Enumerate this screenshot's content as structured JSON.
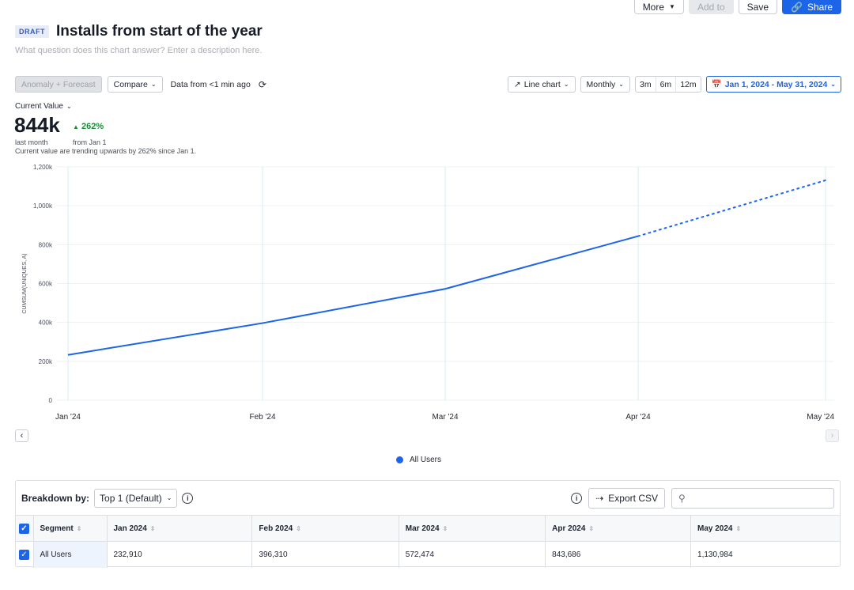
{
  "topbar": {
    "more": "More",
    "add_to": "Add to",
    "save": "Save",
    "share": "Share"
  },
  "header": {
    "badge": "DRAFT",
    "title": "Installs from start of the year",
    "description": "What question does this chart answer? Enter a description here."
  },
  "toolbar": {
    "anomaly": "Anomaly + Forecast",
    "compare": "Compare",
    "data_status": "Data from <1 min ago",
    "chart_type": "Line chart",
    "interval": "Monthly",
    "ranges": [
      "3m",
      "6m",
      "12m"
    ],
    "date_range": "Jan 1, 2024 - May 31, 2024"
  },
  "summary": {
    "label": "Current Value",
    "value": "844k",
    "delta": "262%",
    "value_caption": "last month",
    "delta_caption": "from Jan 1",
    "trend_text": "Current value are trending upwards by 262% since Jan 1."
  },
  "chart_data": {
    "type": "line",
    "ylabel": "CUMSUM(UNIQUES, A)",
    "x": [
      "Jan '24",
      "Feb '24",
      "Mar '24",
      "Apr '24",
      "May '24"
    ],
    "yticks": [
      "0",
      "200k",
      "400k",
      "600k",
      "800k",
      "1,000k",
      "1,200k"
    ],
    "ylim": [
      0,
      1200000
    ],
    "series": [
      {
        "name": "All Users",
        "values": [
          232910,
          396310,
          572474,
          843686,
          1130984
        ],
        "forecast_from_index": 3,
        "color": "#1c64e8"
      }
    ],
    "grid": true,
    "legend": "bottom"
  },
  "legend": {
    "label": "All Users"
  },
  "breakdown": {
    "label": "Breakdown by:",
    "select": "Top 1 (Default)",
    "export": "Export CSV",
    "columns": [
      "Segment",
      "Jan 2024",
      "Feb 2024",
      "Mar 2024",
      "Apr 2024",
      "May 2024"
    ],
    "rows": [
      {
        "segment": "All Users",
        "values": [
          "232,910",
          "396,310",
          "572,474",
          "843,686",
          "1,130,984"
        ]
      }
    ]
  },
  "colors": {
    "accent": "#1c64e8",
    "positive": "#1b8a3a"
  }
}
